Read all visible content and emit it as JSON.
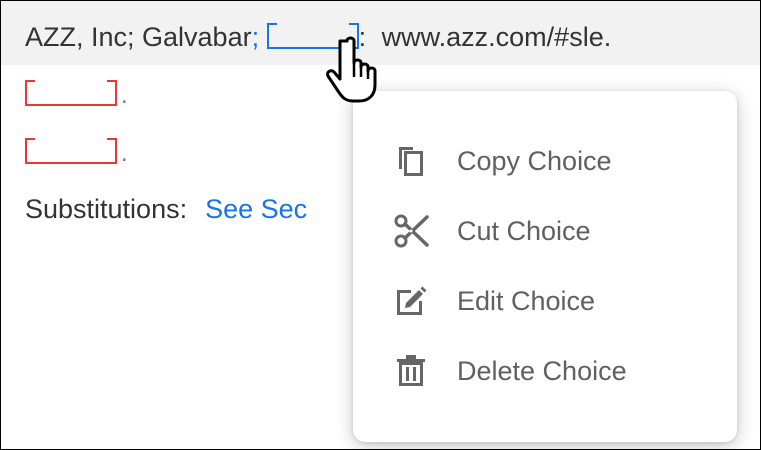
{
  "document": {
    "line1": {
      "prefix": "AZZ, Inc; Galvabar",
      "separator": ";",
      "after_blank": ":",
      "url": "www.azz.com/#sle."
    },
    "line2": {
      "trailing": "."
    },
    "line3": {
      "trailing": "."
    },
    "line4": {
      "label": "Substitutions:",
      "link": "See Sec"
    }
  },
  "context_menu": {
    "items": [
      {
        "label": "Copy Choice",
        "icon": "copy-icon"
      },
      {
        "label": "Cut Choice",
        "icon": "scissors-icon"
      },
      {
        "label": "Edit Choice",
        "icon": "edit-icon"
      },
      {
        "label": "Delete Choice",
        "icon": "trash-icon"
      }
    ]
  },
  "colors": {
    "blank_active": "#1a73e8",
    "blank_empty": "#e53935",
    "link": "#1a73e8",
    "highlight_row": "#f2f2f2",
    "menu_text": "#606060"
  },
  "cursor": "hand-pointer-cursor"
}
